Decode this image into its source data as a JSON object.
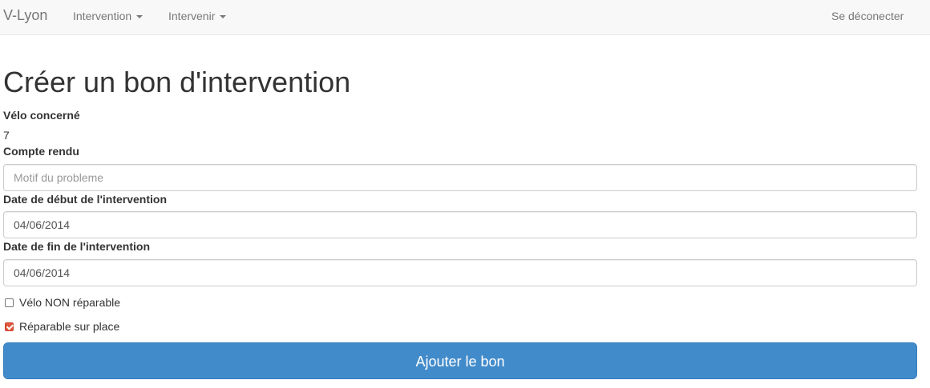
{
  "navbar": {
    "brand": "V-Lyon",
    "menus": [
      {
        "label": "Intervention"
      },
      {
        "label": "Intervenir"
      }
    ],
    "logout_label": "Se déconecter"
  },
  "page": {
    "title": "Créer un bon d'intervention"
  },
  "form": {
    "velo": {
      "label": "Vélo concerné",
      "value": "7"
    },
    "compte_rendu": {
      "label": "Compte rendu",
      "value": "",
      "placeholder": "Motif du probleme"
    },
    "date_debut": {
      "label": "Date de début de l'intervention",
      "value": "04/06/2014"
    },
    "date_fin": {
      "label": "Date de fin de l'intervention",
      "value": "04/06/2014"
    },
    "checkboxes": [
      {
        "label": "Vélo NON réparable",
        "checked": false
      },
      {
        "label": "Réparable sur place",
        "checked": true
      }
    ],
    "submit_label": "Ajouter le bon"
  },
  "colors": {
    "navbar_bg": "#f8f8f8",
    "primary_button": "#428bca",
    "checkbox_checked": "#e2563b"
  }
}
